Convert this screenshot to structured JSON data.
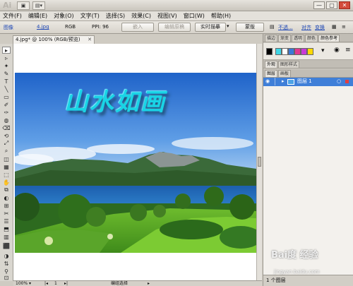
{
  "app": {
    "logo": "Ai",
    "title_controls": [
      "▣",
      "▤▾"
    ],
    "window_buttons": [
      "—",
      "▢",
      "✕"
    ]
  },
  "menu": [
    "文件(F)",
    "编辑(E)",
    "对象(O)",
    "文字(T)",
    "选择(S)",
    "效果(C)",
    "视图(V)",
    "窗口(W)",
    "帮助(H)"
  ],
  "control": {
    "kind": "图像",
    "filename": "4.jpg",
    "mode": "RGB",
    "ppi": "PPI: 96",
    "embed_button": "嵌入",
    "edit_original_button": "编辑原稿",
    "live_trace_button": "实时描摹",
    "mask_button": "蒙版",
    "opacity_label": "不透...",
    "align_label": "对齐",
    "transform_label": "变换"
  },
  "document": {
    "tab_label": "4.jpg* @ 100% (RGB/预览)",
    "close": "✕"
  },
  "artwork": {
    "title": "山水如画"
  },
  "status": {
    "zoom": "100%",
    "page": "1",
    "tool_name": "编组选择"
  },
  "dock": {
    "top_tabs": [
      "描边",
      "渐变",
      "透明",
      "颜色",
      "颜色参考"
    ],
    "mid_tabs": [
      "外观",
      "图形样式"
    ],
    "layer_tabs": [
      "图层",
      "画板"
    ],
    "layer_name": "图层 1",
    "layer_count": "1 个图层",
    "swatches": [
      "#000000",
      "#3fd6e6",
      "#ffffff",
      "#3b79d6",
      "#e23a8f",
      "#c83ad6",
      "#ffd800"
    ]
  },
  "watermark": {
    "brand": "Bai度 经验",
    "url": "jingyan.baidu.com"
  },
  "tools": [
    "▸",
    "▹",
    "✦",
    "✎",
    "T",
    "╲",
    "▭",
    "✐",
    "✑",
    "◍",
    "⌫",
    "⟲",
    "⤢",
    "⌕",
    "◫",
    "▦",
    "⬚",
    "✋",
    "⧉",
    "◐",
    "⊞",
    "✂",
    "☰",
    "⬒",
    "▥",
    "⬛",
    "◑",
    "⇅",
    "⚲",
    "⊡",
    "◻"
  ]
}
